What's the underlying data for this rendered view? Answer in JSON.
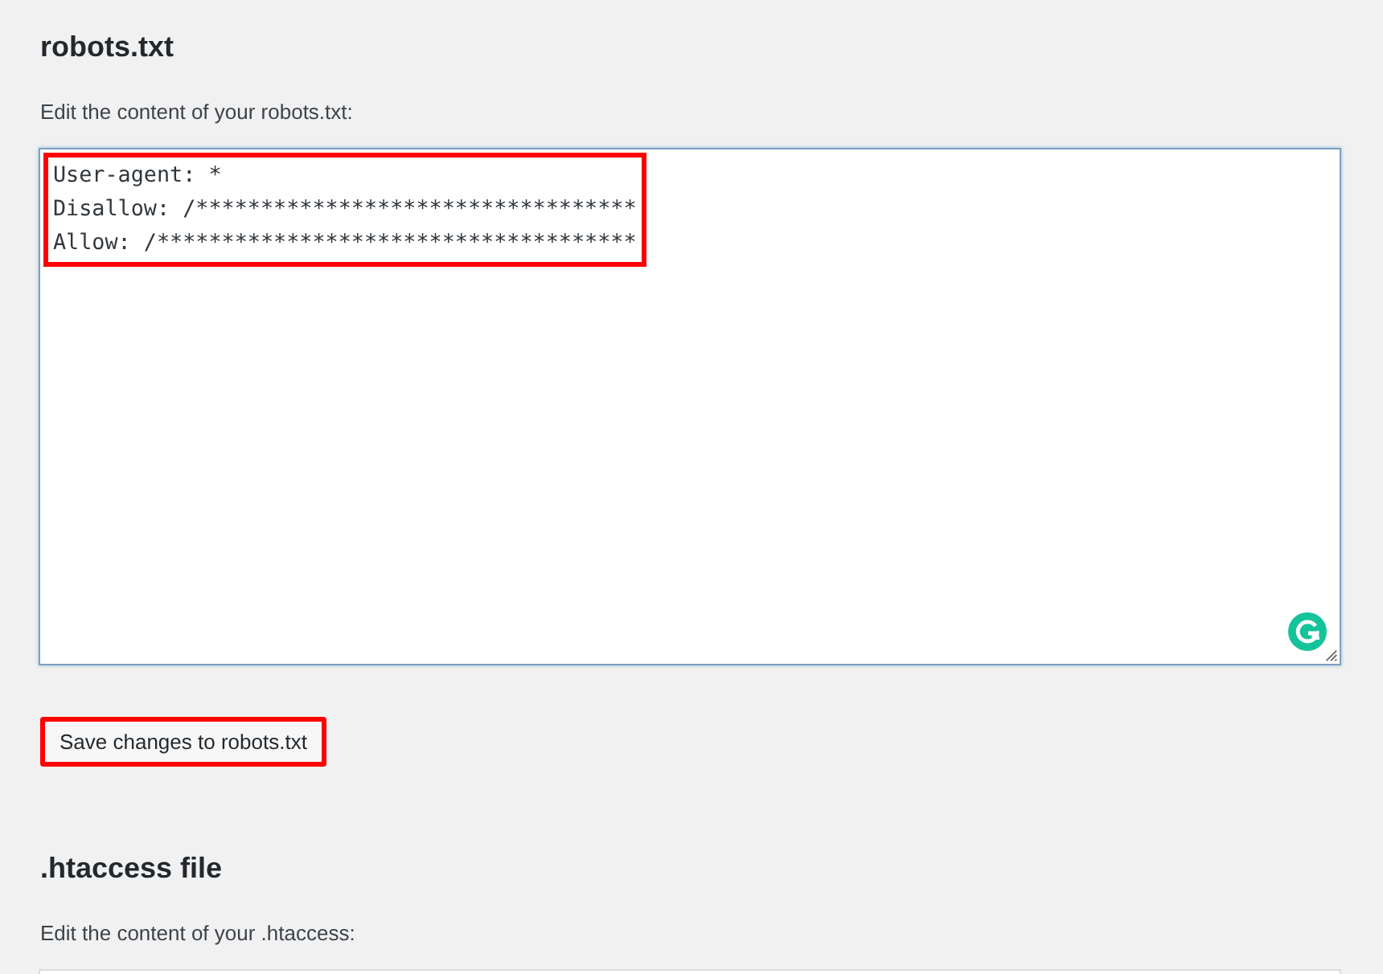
{
  "sections": [
    {
      "heading": "robots.txt",
      "description": "Edit the content of your robots.txt:",
      "editor": {
        "lines": [
          "User-agent: *",
          "Disallow: /**********************************",
          "Allow: /*************************************"
        ],
        "highlighted": true
      },
      "button": {
        "label": "Save changes to robots.txt",
        "highlighted": true
      }
    },
    {
      "heading": ".htaccess file",
      "description": "Edit the content of your .htaccess:"
    }
  ]
}
